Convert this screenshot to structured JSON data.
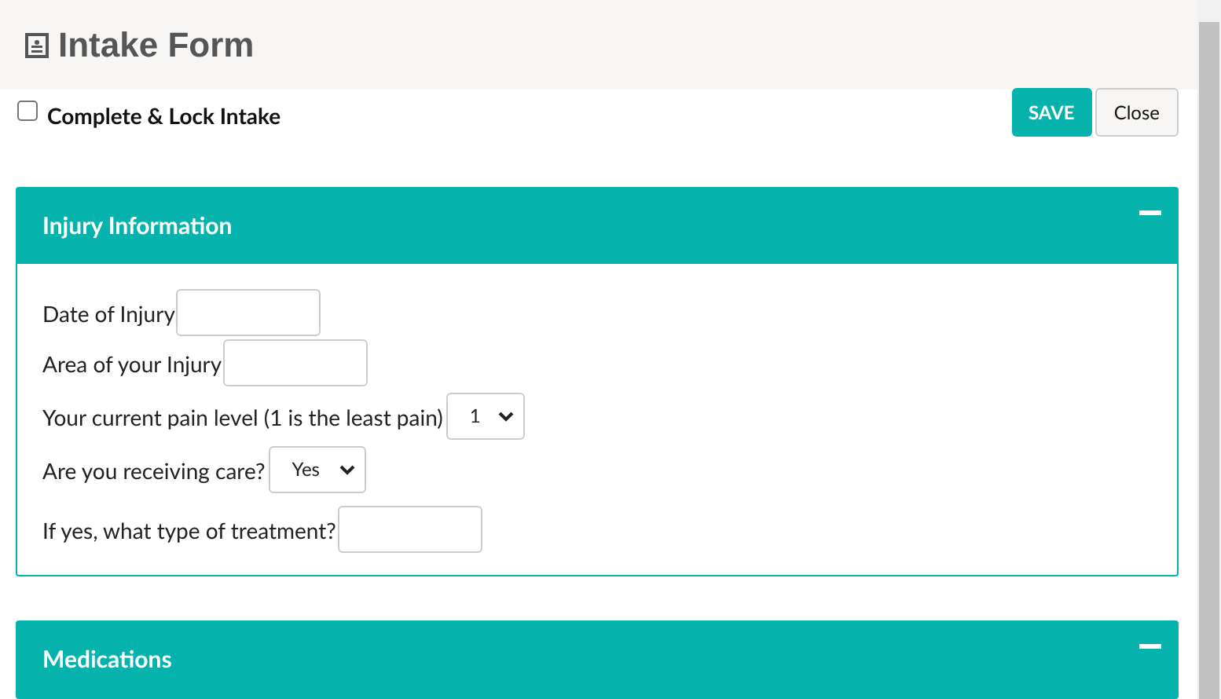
{
  "window": {
    "title": "Intake Form"
  },
  "lock": {
    "label": "Complete & Lock Intake",
    "checked": false
  },
  "buttons": [
    {
      "label": "SAVE",
      "kind": "primary"
    },
    {
      "label": "Close",
      "kind": "secondary"
    }
  ],
  "panels": [
    {
      "title": "Injury Information",
      "expanded": true,
      "fields": [
        {
          "label": "Date of Injury",
          "kind": "text"
        },
        {
          "label": "Area of your Injury",
          "kind": "text"
        },
        {
          "label": "Your current pain level (1 is the least pain)",
          "kind": "select",
          "value": "1"
        },
        {
          "label": "Are you receiving care?",
          "kind": "select",
          "value": "Yes"
        },
        {
          "label": "If yes, what type of treatment?",
          "kind": "text"
        }
      ]
    },
    {
      "title": "Medications",
      "expanded": true
    }
  ]
}
